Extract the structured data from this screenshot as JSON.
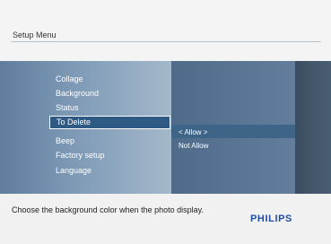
{
  "header": {
    "title": "Setup Menu"
  },
  "menu": {
    "items": [
      {
        "label": "Collage"
      },
      {
        "label": "Background"
      },
      {
        "label": "Status"
      },
      {
        "label": "To Delete"
      },
      {
        "label": "Beep"
      },
      {
        "label": "Factory setup"
      },
      {
        "label": "Language"
      }
    ],
    "selected_index": 3
  },
  "options": {
    "items": [
      {
        "label": "< Allow >"
      },
      {
        "label": "Not Allow"
      }
    ],
    "selected_index": 0
  },
  "footer": {
    "hint": "Choose the background color when the photo display.",
    "brand": "PHILIPS"
  },
  "colors": {
    "brand": "#1f4fa5",
    "menu_highlight": "#2f5a84",
    "option_highlight": "#3e6488"
  }
}
